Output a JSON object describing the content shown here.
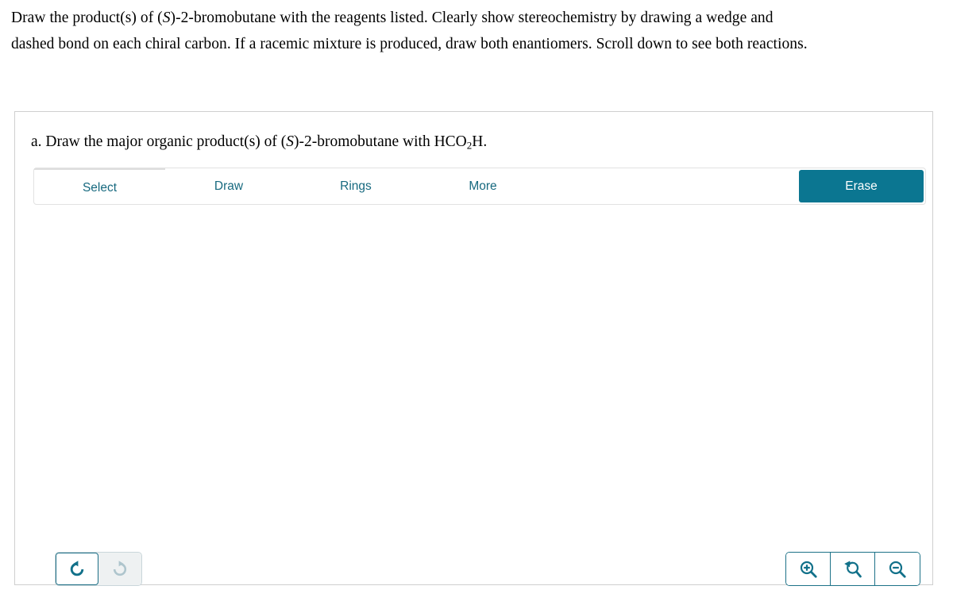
{
  "prompt": {
    "line1_a": "Draw the product(s) of (",
    "line1_italic": "S",
    "line1_b": ")-2-bromobutane with the reagents listed. Clearly show stereochemistry by drawing a wedge and",
    "line2": "dashed bond on each chiral carbon. If a racemic mixture is produced, draw both enantiomers. Scroll down to see both reactions."
  },
  "question": {
    "label": "a. Draw the major organic product(s) of (",
    "stereo_descriptor": "S",
    "after_descriptor": ")-2-bromobutane with HCO",
    "formula_subscript": "2",
    "formula_tail": "H."
  },
  "editor": {
    "tabs": [
      {
        "label": "Select",
        "active": true
      },
      {
        "label": "Draw",
        "active": false
      },
      {
        "label": "Rings",
        "active": false
      },
      {
        "label": "More",
        "active": false
      }
    ],
    "erase_label": "Erase",
    "history": [
      {
        "name": "undo",
        "enabled": true
      },
      {
        "name": "redo",
        "enabled": false
      }
    ],
    "zoom_controls": [
      {
        "name": "zoom-in"
      },
      {
        "name": "zoom-reset"
      },
      {
        "name": "zoom-out"
      }
    ]
  },
  "colors": {
    "accent_teal": "#0b7691",
    "tab_text": "#17697f",
    "icon_active": "#12718a",
    "icon_disabled": "#aec5cd",
    "card_border": "#cfcfcf",
    "toolbar_border": "#e2e2e2"
  }
}
